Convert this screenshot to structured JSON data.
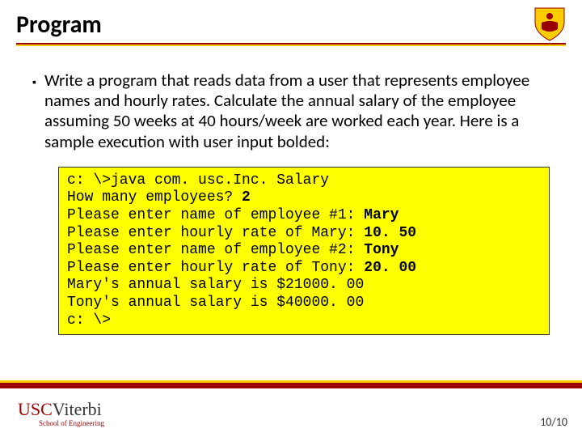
{
  "header": {
    "title": "Program"
  },
  "bullet": {
    "text": "Write a program that reads data from a user that represents employee names and hourly rates. Calculate the annual salary of the employee assuming 50 weeks at 40 hours/week are worked each year. Here is a sample execution with user input bolded:"
  },
  "code": {
    "lines": [
      {
        "prompt": "c: \\>java com. usc.Inc. Salary",
        "input": ""
      },
      {
        "prompt": "How many employees? ",
        "input": "2"
      },
      {
        "prompt": "Please enter name of employee #1: ",
        "input": "Mary"
      },
      {
        "prompt": "Please enter hourly rate of Mary: ",
        "input": "10. 50"
      },
      {
        "prompt": "Please enter name of employee #2: ",
        "input": "Tony"
      },
      {
        "prompt": "Please enter hourly rate of Tony: ",
        "input": "20. 00"
      },
      {
        "prompt": "Mary's annual salary is $21000. 00",
        "input": ""
      },
      {
        "prompt": "Tony's annual salary is $40000. 00",
        "input": ""
      },
      {
        "prompt": "c: \\>",
        "input": ""
      }
    ]
  },
  "footer": {
    "logo_usc": "USC",
    "logo_viterbi": "Viterbi",
    "logo_sub": "School of Engineering",
    "page": "10/10"
  }
}
